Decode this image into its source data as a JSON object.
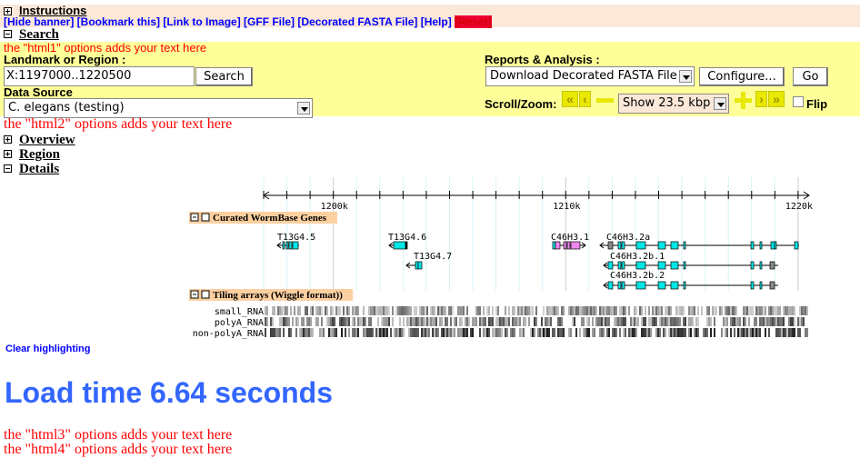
{
  "banner": {
    "instructions": "Instructions",
    "links": [
      "[Hide banner]",
      "[Bookmark this]",
      "[Link to Image]",
      "[GFF File]",
      "[Decorated FASTA File]",
      "[Help]"
    ],
    "reset": "[Reset]"
  },
  "search": {
    "title": "Search",
    "html1": "the \"html1\" options adds your text here",
    "landmark_label": "Landmark or Region",
    "landmark_value": "X:1197000..1220500",
    "search_button": "Search",
    "source_label": "Data Source",
    "source_value": "C. elegans (testing)",
    "reports_label": "Reports & Analysis",
    "reports_value": "Download Decorated FASTA File",
    "configure_button": "Configure...",
    "go_button": "Go",
    "scroll_label": "Scroll/Zoom:",
    "zoom_value": "Show 23.5 kbp",
    "flip_label": "Flip",
    "flip_checked": false
  },
  "html2": "the \"html2\" options adds your text here",
  "sections": [
    "Overview",
    "Region",
    "Details"
  ],
  "ruler": {
    "ticks": [
      "1200k",
      "1210k",
      "1220k"
    ]
  },
  "tracks": {
    "genes_title": "Curated WormBase Genes",
    "genes": [
      "T13G4.5",
      "T13G4.6",
      "T13G4.7",
      "C46H3.1",
      "C46H3.2a",
      "C46H3.2b.1",
      "C46H3.2b.2"
    ],
    "tiling_title": "Tiling arrays (Wiggle format))",
    "tiling_rows": [
      "small_RNA",
      "polyA_RNA",
      "non-polyA_RNA"
    ]
  },
  "clear_highlighting": "Clear highlighting",
  "load_time": "Load time 6.64 seconds",
  "html3": "the \"html3\" options adds your text here",
  "html4": "the \"html4\" options adds your text here",
  "colors": {
    "banner_bg": "#fbe8d8",
    "panel_bg": "#ffff99",
    "link": "#0000ff",
    "reset_bg": "#ee0033",
    "load_time": "#3366ff",
    "exon": "#00e5e5",
    "exon_pink": "#ee88ee",
    "track_label_bg": "#fcd0a0"
  }
}
